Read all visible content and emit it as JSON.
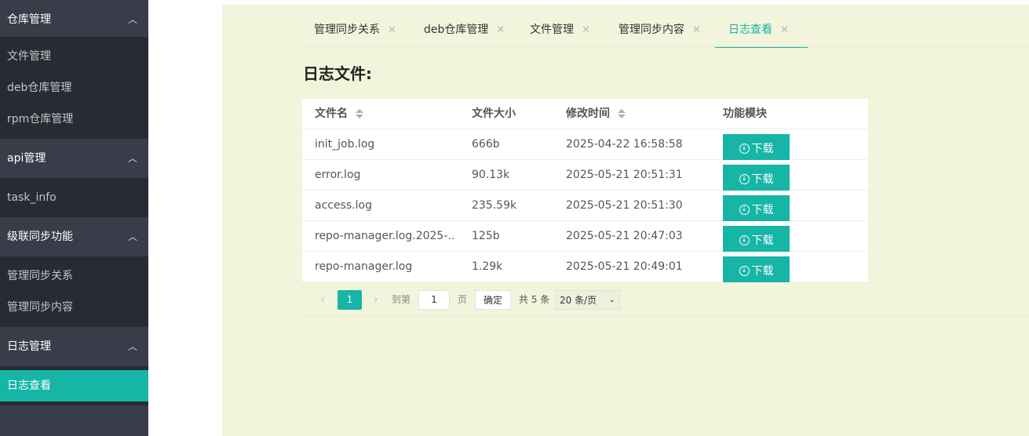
{
  "sidebar": {
    "groups": [
      {
        "title": "仓库管理",
        "items": [
          "文件管理",
          "deb仓库管理",
          "rpm仓库管理"
        ]
      },
      {
        "title": "api管理",
        "items": [
          "task_info"
        ]
      },
      {
        "title": "级联同步功能",
        "items": [
          "管理同步关系",
          "管理同步内容"
        ]
      },
      {
        "title": "日志管理",
        "items": [
          "日志查看"
        ]
      }
    ],
    "expand_icon": "chevron-up-icon",
    "active_item": "日志查看"
  },
  "tabs": [
    {
      "label": "管理同步关系",
      "close": "✕"
    },
    {
      "label": "deb仓库管理",
      "close": "✕"
    },
    {
      "label": "文件管理",
      "close": "✕"
    },
    {
      "label": "管理同步内容",
      "close": "✕"
    },
    {
      "label": "日志查看",
      "close": "✕",
      "active": true
    }
  ],
  "page_title": "日志文件:",
  "table": {
    "headers": {
      "name": "文件名",
      "size": "文件大小",
      "mtime": "修改时间",
      "action": "功能模块"
    },
    "rows": [
      {
        "name": "init_job.log",
        "size": "666b",
        "mtime": "2025-04-22 16:58:58",
        "action": "下载"
      },
      {
        "name": "error.log",
        "size": "90.13k",
        "mtime": "2025-05-21 20:51:31",
        "action": "下载"
      },
      {
        "name": "access.log",
        "size": "235.59k",
        "mtime": "2025-05-21 20:51:30",
        "action": "下载"
      },
      {
        "name": "repo-manager.log.2025-…",
        "size": "125b",
        "mtime": "2025-05-21 20:47:03",
        "action": "下载"
      },
      {
        "name": "repo-manager.log",
        "size": "1.29k",
        "mtime": "2025-05-21 20:49:01",
        "action": "下载"
      }
    ]
  },
  "pagination": {
    "current_page": "1",
    "goto_prefix": "到第",
    "goto_value": "1",
    "goto_suffix": "页",
    "confirm": "确定",
    "total": "共 5 条",
    "page_size": "20 条/页"
  },
  "colors": {
    "accent": "#16b5a6",
    "sidebar_bg": "#393d49",
    "sidebar_sub_bg": "#282b33",
    "content_bg": "#f3f4dc"
  }
}
